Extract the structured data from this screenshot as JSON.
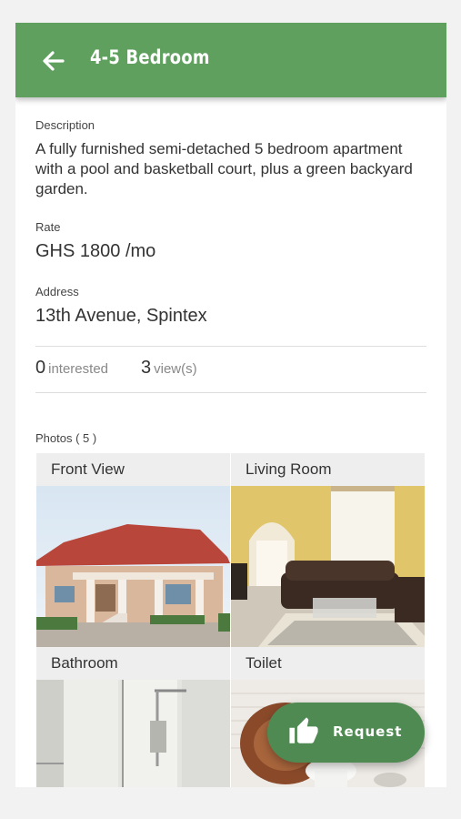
{
  "header": {
    "title": "4-5 Bedroom"
  },
  "listing": {
    "description_label": "Description",
    "description": "A fully furnished semi-detached 5 bedroom apartment with a pool and basketball court, plus a green backyard garden.",
    "rate_label": "Rate",
    "rate": "GHS 1800 /mo",
    "address_label": "Address",
    "address": "13th Avenue, Spintex"
  },
  "stats": {
    "interested_count": "0",
    "interested_label": "interested",
    "views_count": "3",
    "views_label": "view(s)"
  },
  "photos": {
    "label": "Photos ( 5 )",
    "items": [
      {
        "caption": "Front View"
      },
      {
        "caption": "Living Room"
      },
      {
        "caption": "Bathroom"
      },
      {
        "caption": "Toilet"
      }
    ]
  },
  "fab": {
    "label": "Request",
    "icon": "thumbs-up-icon"
  },
  "colors": {
    "appbar": "#5fa05f",
    "fab": "#4f8a52"
  }
}
